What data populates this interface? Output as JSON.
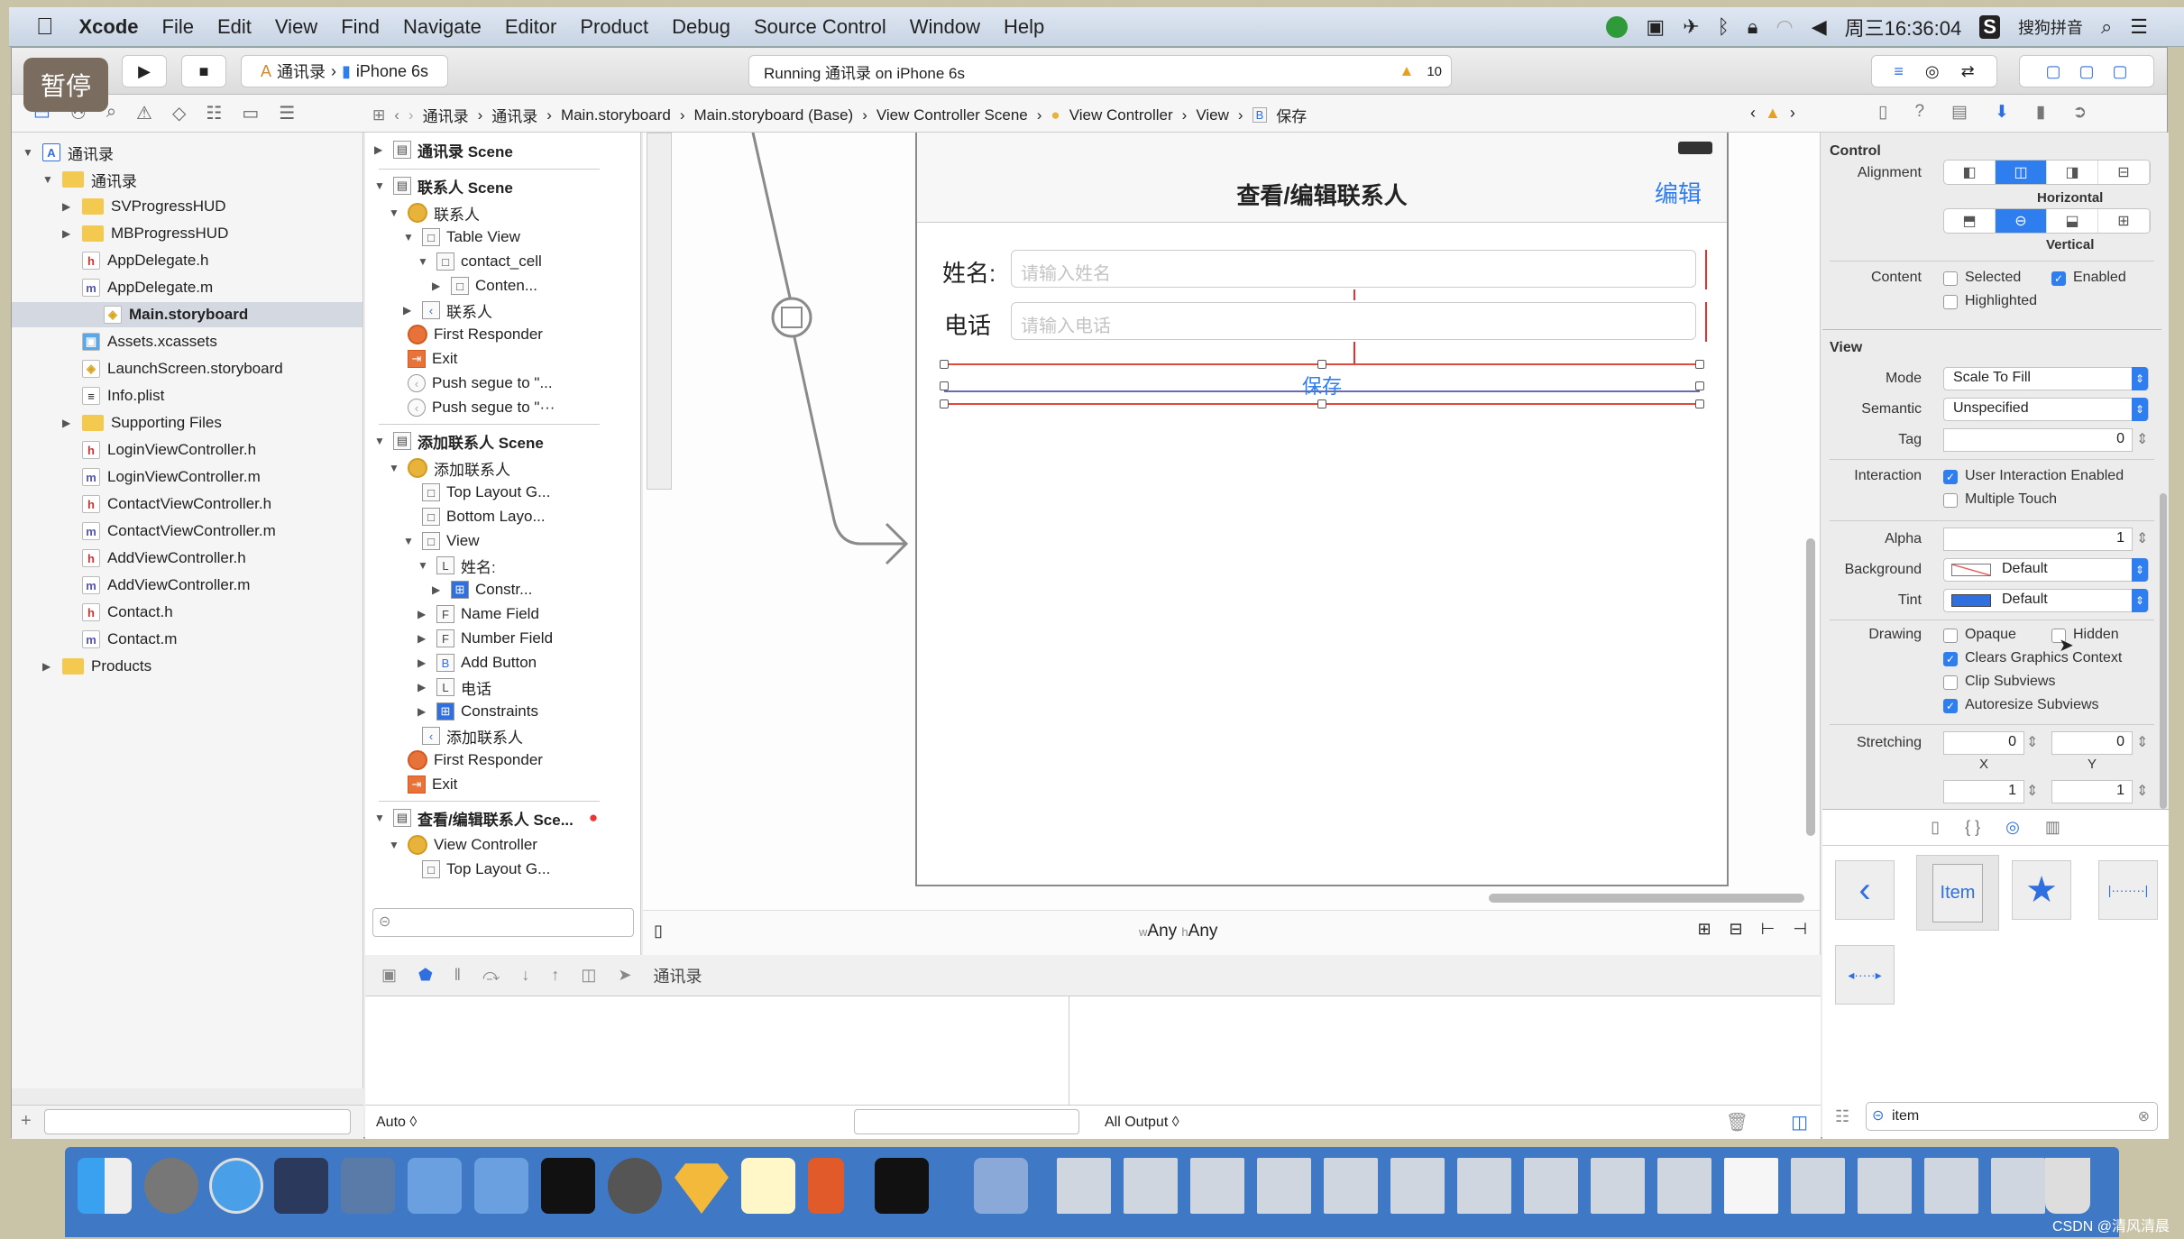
{
  "menubar": {
    "apple": "",
    "app": "Xcode",
    "items": [
      "File",
      "Edit",
      "View",
      "Find",
      "Navigate",
      "Editor",
      "Product",
      "Debug",
      "Source Control",
      "Window",
      "Help"
    ],
    "clock": "周三16:36:04",
    "input_method": "搜狗拼音"
  },
  "overlay": {
    "pause_label": "暂停"
  },
  "toolbar": {
    "scheme": "通讯录",
    "device": "iPhone 6s",
    "status": "Running 通讯录 on iPhone 6s",
    "warning_count": "10"
  },
  "breadcrumb": [
    "通讯录",
    "通讯录",
    "Main.storyboard",
    "Main.storyboard (Base)",
    "View Controller Scene",
    "View Controller",
    "View",
    "保存"
  ],
  "file_navigator": {
    "items": [
      {
        "label": "通讯录",
        "type": "project",
        "depth": 0,
        "expanded": true
      },
      {
        "label": "通讯录",
        "type": "folder",
        "depth": 1,
        "expanded": true
      },
      {
        "label": "SVProgressHUD",
        "type": "folder",
        "depth": 2,
        "expanded": false
      },
      {
        "label": "MBProgressHUD",
        "type": "folder",
        "depth": 2,
        "expanded": false
      },
      {
        "label": "AppDelegate.h",
        "type": "h",
        "depth": 2
      },
      {
        "label": "AppDelegate.m",
        "type": "m",
        "depth": 2
      },
      {
        "label": "Main.storyboard",
        "type": "storyboard",
        "depth": 2,
        "selected": true
      },
      {
        "label": "Assets.xcassets",
        "type": "assets",
        "depth": 2
      },
      {
        "label": "LaunchScreen.storyboard",
        "type": "storyboard",
        "depth": 2
      },
      {
        "label": "Info.plist",
        "type": "plist",
        "depth": 2
      },
      {
        "label": "Supporting Files",
        "type": "folder",
        "depth": 2,
        "expanded": false
      },
      {
        "label": "LoginViewController.h",
        "type": "h",
        "depth": 2
      },
      {
        "label": "LoginViewController.m",
        "type": "m",
        "depth": 2
      },
      {
        "label": "ContactViewController.h",
        "type": "h",
        "depth": 2
      },
      {
        "label": "ContactViewController.m",
        "type": "m",
        "depth": 2
      },
      {
        "label": "AddViewController.h",
        "type": "h",
        "depth": 2
      },
      {
        "label": "AddViewController.m",
        "type": "m",
        "depth": 2
      },
      {
        "label": "Contact.h",
        "type": "h",
        "depth": 2
      },
      {
        "label": "Contact.m",
        "type": "m",
        "depth": 2
      },
      {
        "label": "Products",
        "type": "folder",
        "depth": 1,
        "expanded": false
      }
    ]
  },
  "outline": {
    "items": [
      {
        "label": "通讯录 Scene",
        "icon": "scene",
        "depth": 0,
        "tri": "▶"
      },
      {
        "label": "联系人 Scene",
        "icon": "scene",
        "depth": 0,
        "tri": "▼",
        "divider_before": true
      },
      {
        "label": "联系人",
        "icon": "vc",
        "depth": 1,
        "tri": "▼"
      },
      {
        "label": "Table View",
        "icon": "box",
        "depth": 2,
        "tri": "▼"
      },
      {
        "label": "contact_cell",
        "icon": "box",
        "depth": 3,
        "tri": "▼"
      },
      {
        "label": "Conten...",
        "icon": "box",
        "depth": 4,
        "tri": "▶"
      },
      {
        "label": "联系人",
        "icon": "back",
        "depth": 2,
        "tri": "▶"
      },
      {
        "label": "First Responder",
        "icon": "responder",
        "depth": 1,
        "tri": ""
      },
      {
        "label": "Exit",
        "icon": "exit",
        "depth": 1,
        "tri": ""
      },
      {
        "label": "Push segue to \"...",
        "icon": "segue",
        "depth": 1,
        "tri": ""
      },
      {
        "label": "Push segue to \"···",
        "icon": "segue",
        "depth": 1,
        "tri": ""
      },
      {
        "label": "添加联系人 Scene",
        "icon": "scene",
        "depth": 0,
        "tri": "▼",
        "divider_before": true
      },
      {
        "label": "添加联系人",
        "icon": "vc",
        "depth": 1,
        "tri": "▼"
      },
      {
        "label": "Top Layout G...",
        "icon": "box",
        "depth": 2,
        "tri": ""
      },
      {
        "label": "Bottom Layo...",
        "icon": "box",
        "depth": 2,
        "tri": ""
      },
      {
        "label": "View",
        "icon": "box",
        "depth": 2,
        "tri": "▼"
      },
      {
        "label": "姓名:",
        "icon": "L",
        "depth": 3,
        "tri": "▼"
      },
      {
        "label": "Constr...",
        "icon": "constraint",
        "depth": 4,
        "tri": "▶"
      },
      {
        "label": "Name Field",
        "icon": "F",
        "depth": 3,
        "tri": "▶"
      },
      {
        "label": "Number Field",
        "icon": "F",
        "depth": 3,
        "tri": "▶"
      },
      {
        "label": "Add Button",
        "icon": "B",
        "depth": 3,
        "tri": "▶"
      },
      {
        "label": "电话",
        "icon": "L",
        "depth": 3,
        "tri": "▶"
      },
      {
        "label": "Constraints",
        "icon": "constraint",
        "depth": 3,
        "tri": "▶"
      },
      {
        "label": "添加联系人",
        "icon": "back",
        "depth": 2,
        "tri": ""
      },
      {
        "label": "First Responder",
        "icon": "responder",
        "depth": 1,
        "tri": ""
      },
      {
        "label": "Exit",
        "icon": "exit",
        "depth": 1,
        "tri": ""
      },
      {
        "label": "查看/编辑联系人 Sce...",
        "icon": "scene",
        "depth": 0,
        "tri": "▼",
        "divider_before": true,
        "error": true
      },
      {
        "label": "View Controller",
        "icon": "vc",
        "depth": 1,
        "tri": "▼"
      },
      {
        "label": "Top Layout G...",
        "icon": "box",
        "depth": 2,
        "tri": ""
      }
    ],
    "filter_placeholder": ""
  },
  "canvas": {
    "nav_title": "查看/编辑联系人",
    "nav_right": "编辑",
    "name_label": "姓名:",
    "name_placeholder": "请输入姓名",
    "phone_label": "电话",
    "phone_placeholder": "请输入电话",
    "save_button": "保存",
    "size_class_w": "Any",
    "size_class_h": "Any",
    "w_prefix": "w",
    "h_prefix": "h"
  },
  "debug": {
    "scheme": "通讯录",
    "auto_label": "Auto ◊",
    "output_label": "All Output ◊"
  },
  "inspector": {
    "control_header": "Control",
    "alignment_label": "Alignment",
    "horizontal_label": "Horizontal",
    "vertical_label": "Vertical",
    "horizontal_selected": 1,
    "vertical_selected": 1,
    "content_label": "Content",
    "selected": {
      "label": "Selected",
      "checked": false
    },
    "enabled": {
      "label": "Enabled",
      "checked": true
    },
    "highlighted": {
      "label": "Highlighted",
      "checked": false
    },
    "view_header": "View",
    "mode_label": "Mode",
    "mode_value": "Scale To Fill",
    "semantic_label": "Semantic",
    "semantic_value": "Unspecified",
    "tag_label": "Tag",
    "tag_value": "0",
    "interaction_label": "Interaction",
    "user_interaction": {
      "label": "User Interaction Enabled",
      "checked": true
    },
    "multiple_touch": {
      "label": "Multiple Touch",
      "checked": false
    },
    "alpha_label": "Alpha",
    "alpha_value": "1",
    "background_label": "Background",
    "background_value": "Default",
    "tint_label": "Tint",
    "tint_value": "Default",
    "tint_color": "#2f6fe0",
    "drawing_label": "Drawing",
    "opaque": {
      "label": "Opaque",
      "checked": false
    },
    "hidden": {
      "label": "Hidden",
      "checked": false
    },
    "clears_graphics": {
      "label": "Clears Graphics Context",
      "checked": true
    },
    "clip_subviews": {
      "label": "Clip Subviews",
      "checked": false
    },
    "autoresize": {
      "label": "Autoresize Subviews",
      "checked": true
    },
    "stretching_label": "Stretching",
    "stretch_x": "0",
    "stretch_y": "0",
    "stretch_w": "1",
    "stretch_h": "1",
    "x_label": "X",
    "y_label": "Y"
  },
  "library": {
    "items": [
      "back-bar-button",
      "Item",
      "star-bar-item",
      "fixed-space",
      "flexible-space"
    ],
    "item_label": "Item",
    "search_value": "item"
  },
  "watermark": "CSDN @清风清晨"
}
